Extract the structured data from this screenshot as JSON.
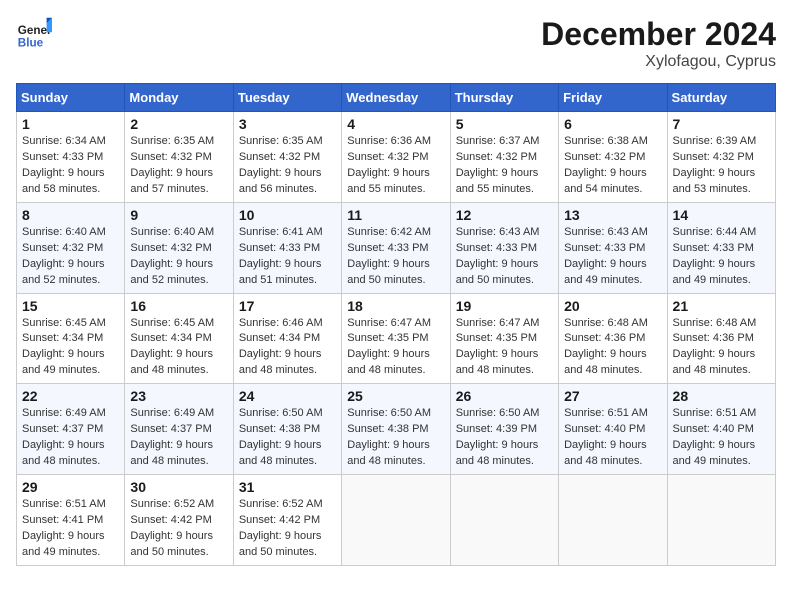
{
  "header": {
    "logo_general": "General",
    "logo_blue": "Blue",
    "month_title": "December 2024",
    "location": "Xylofagou, Cyprus"
  },
  "weekdays": [
    "Sunday",
    "Monday",
    "Tuesday",
    "Wednesday",
    "Thursday",
    "Friday",
    "Saturday"
  ],
  "weeks": [
    [
      {
        "day": "1",
        "sunrise": "6:34 AM",
        "sunset": "4:33 PM",
        "daylight": "9 hours and 58 minutes."
      },
      {
        "day": "2",
        "sunrise": "6:35 AM",
        "sunset": "4:32 PM",
        "daylight": "9 hours and 57 minutes."
      },
      {
        "day": "3",
        "sunrise": "6:35 AM",
        "sunset": "4:32 PM",
        "daylight": "9 hours and 56 minutes."
      },
      {
        "day": "4",
        "sunrise": "6:36 AM",
        "sunset": "4:32 PM",
        "daylight": "9 hours and 55 minutes."
      },
      {
        "day": "5",
        "sunrise": "6:37 AM",
        "sunset": "4:32 PM",
        "daylight": "9 hours and 55 minutes."
      },
      {
        "day": "6",
        "sunrise": "6:38 AM",
        "sunset": "4:32 PM",
        "daylight": "9 hours and 54 minutes."
      },
      {
        "day": "7",
        "sunrise": "6:39 AM",
        "sunset": "4:32 PM",
        "daylight": "9 hours and 53 minutes."
      }
    ],
    [
      {
        "day": "8",
        "sunrise": "6:40 AM",
        "sunset": "4:32 PM",
        "daylight": "9 hours and 52 minutes."
      },
      {
        "day": "9",
        "sunrise": "6:40 AM",
        "sunset": "4:32 PM",
        "daylight": "9 hours and 52 minutes."
      },
      {
        "day": "10",
        "sunrise": "6:41 AM",
        "sunset": "4:33 PM",
        "daylight": "9 hours and 51 minutes."
      },
      {
        "day": "11",
        "sunrise": "6:42 AM",
        "sunset": "4:33 PM",
        "daylight": "9 hours and 50 minutes."
      },
      {
        "day": "12",
        "sunrise": "6:43 AM",
        "sunset": "4:33 PM",
        "daylight": "9 hours and 50 minutes."
      },
      {
        "day": "13",
        "sunrise": "6:43 AM",
        "sunset": "4:33 PM",
        "daylight": "9 hours and 49 minutes."
      },
      {
        "day": "14",
        "sunrise": "6:44 AM",
        "sunset": "4:33 PM",
        "daylight": "9 hours and 49 minutes."
      }
    ],
    [
      {
        "day": "15",
        "sunrise": "6:45 AM",
        "sunset": "4:34 PM",
        "daylight": "9 hours and 49 minutes."
      },
      {
        "day": "16",
        "sunrise": "6:45 AM",
        "sunset": "4:34 PM",
        "daylight": "9 hours and 48 minutes."
      },
      {
        "day": "17",
        "sunrise": "6:46 AM",
        "sunset": "4:34 PM",
        "daylight": "9 hours and 48 minutes."
      },
      {
        "day": "18",
        "sunrise": "6:47 AM",
        "sunset": "4:35 PM",
        "daylight": "9 hours and 48 minutes."
      },
      {
        "day": "19",
        "sunrise": "6:47 AM",
        "sunset": "4:35 PM",
        "daylight": "9 hours and 48 minutes."
      },
      {
        "day": "20",
        "sunrise": "6:48 AM",
        "sunset": "4:36 PM",
        "daylight": "9 hours and 48 minutes."
      },
      {
        "day": "21",
        "sunrise": "6:48 AM",
        "sunset": "4:36 PM",
        "daylight": "9 hours and 48 minutes."
      }
    ],
    [
      {
        "day": "22",
        "sunrise": "6:49 AM",
        "sunset": "4:37 PM",
        "daylight": "9 hours and 48 minutes."
      },
      {
        "day": "23",
        "sunrise": "6:49 AM",
        "sunset": "4:37 PM",
        "daylight": "9 hours and 48 minutes."
      },
      {
        "day": "24",
        "sunrise": "6:50 AM",
        "sunset": "4:38 PM",
        "daylight": "9 hours and 48 minutes."
      },
      {
        "day": "25",
        "sunrise": "6:50 AM",
        "sunset": "4:38 PM",
        "daylight": "9 hours and 48 minutes."
      },
      {
        "day": "26",
        "sunrise": "6:50 AM",
        "sunset": "4:39 PM",
        "daylight": "9 hours and 48 minutes."
      },
      {
        "day": "27",
        "sunrise": "6:51 AM",
        "sunset": "4:40 PM",
        "daylight": "9 hours and 48 minutes."
      },
      {
        "day": "28",
        "sunrise": "6:51 AM",
        "sunset": "4:40 PM",
        "daylight": "9 hours and 49 minutes."
      }
    ],
    [
      {
        "day": "29",
        "sunrise": "6:51 AM",
        "sunset": "4:41 PM",
        "daylight": "9 hours and 49 minutes."
      },
      {
        "day": "30",
        "sunrise": "6:52 AM",
        "sunset": "4:42 PM",
        "daylight": "9 hours and 50 minutes."
      },
      {
        "day": "31",
        "sunrise": "6:52 AM",
        "sunset": "4:42 PM",
        "daylight": "9 hours and 50 minutes."
      },
      null,
      null,
      null,
      null
    ]
  ]
}
